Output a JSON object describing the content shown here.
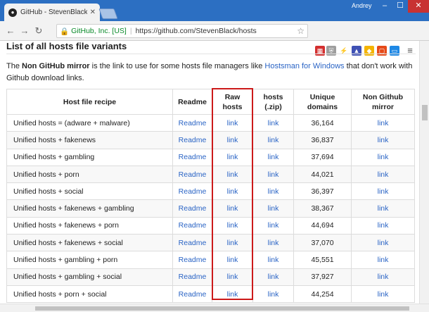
{
  "browser": {
    "tab_title": "GitHub - StevenBlack/ho",
    "tab_close": "✕",
    "user_name": "Andrey",
    "secure_label": "GitHub, Inc. [US]",
    "url_separator": "|",
    "url": "https://github.com/StevenBlack/hosts",
    "win_min": "–",
    "win_max": "☐",
    "win_close": "✕"
  },
  "page": {
    "heading": "List of all hosts file variants",
    "intro_pre": "The ",
    "intro_bold": "Non GitHub mirror",
    "intro_mid": " is the link to use for some hosts file managers like ",
    "intro_link": "Hostsman for Windows",
    "intro_post": " that don't work with Github download links."
  },
  "table": {
    "headers": [
      "Host file recipe",
      "Readme",
      "Raw hosts",
      "hosts (.zip)",
      "Unique domains",
      "Non Github mirror"
    ],
    "rows": [
      {
        "recipe": "Unified hosts = (adware + malware)",
        "readme": "Readme",
        "raw": "link",
        "zip": "link",
        "domains": "36,164",
        "mirror": "link"
      },
      {
        "recipe": "Unified hosts + fakenews",
        "readme": "Readme",
        "raw": "link",
        "zip": "link",
        "domains": "36,837",
        "mirror": "link"
      },
      {
        "recipe": "Unified hosts + gambling",
        "readme": "Readme",
        "raw": "link",
        "zip": "link",
        "domains": "37,694",
        "mirror": "link"
      },
      {
        "recipe": "Unified hosts + porn",
        "readme": "Readme",
        "raw": "link",
        "zip": "link",
        "domains": "44,021",
        "mirror": "link"
      },
      {
        "recipe": "Unified hosts + social",
        "readme": "Readme",
        "raw": "link",
        "zip": "link",
        "domains": "36,397",
        "mirror": "link"
      },
      {
        "recipe": "Unified hosts + fakenews + gambling",
        "readme": "Readme",
        "raw": "link",
        "zip": "link",
        "domains": "38,367",
        "mirror": "link"
      },
      {
        "recipe": "Unified hosts + fakenews + porn",
        "readme": "Readme",
        "raw": "link",
        "zip": "link",
        "domains": "44,694",
        "mirror": "link"
      },
      {
        "recipe": "Unified hosts + fakenews + social",
        "readme": "Readme",
        "raw": "link",
        "zip": "link",
        "domains": "37,070",
        "mirror": "link"
      },
      {
        "recipe": "Unified hosts + gambling + porn",
        "readme": "Readme",
        "raw": "link",
        "zip": "link",
        "domains": "45,551",
        "mirror": "link"
      },
      {
        "recipe": "Unified hosts + gambling + social",
        "readme": "Readme",
        "raw": "link",
        "zip": "link",
        "domains": "37,927",
        "mirror": "link"
      },
      {
        "recipe": "Unified hosts + porn + social",
        "readme": "Readme",
        "raw": "link",
        "zip": "link",
        "domains": "44,254",
        "mirror": "link"
      }
    ]
  },
  "colors": {
    "titlebar": "#2c6fc2",
    "link": "#2a64c5",
    "highlight": "#cc1a1a",
    "secure": "#0a8a2a"
  }
}
